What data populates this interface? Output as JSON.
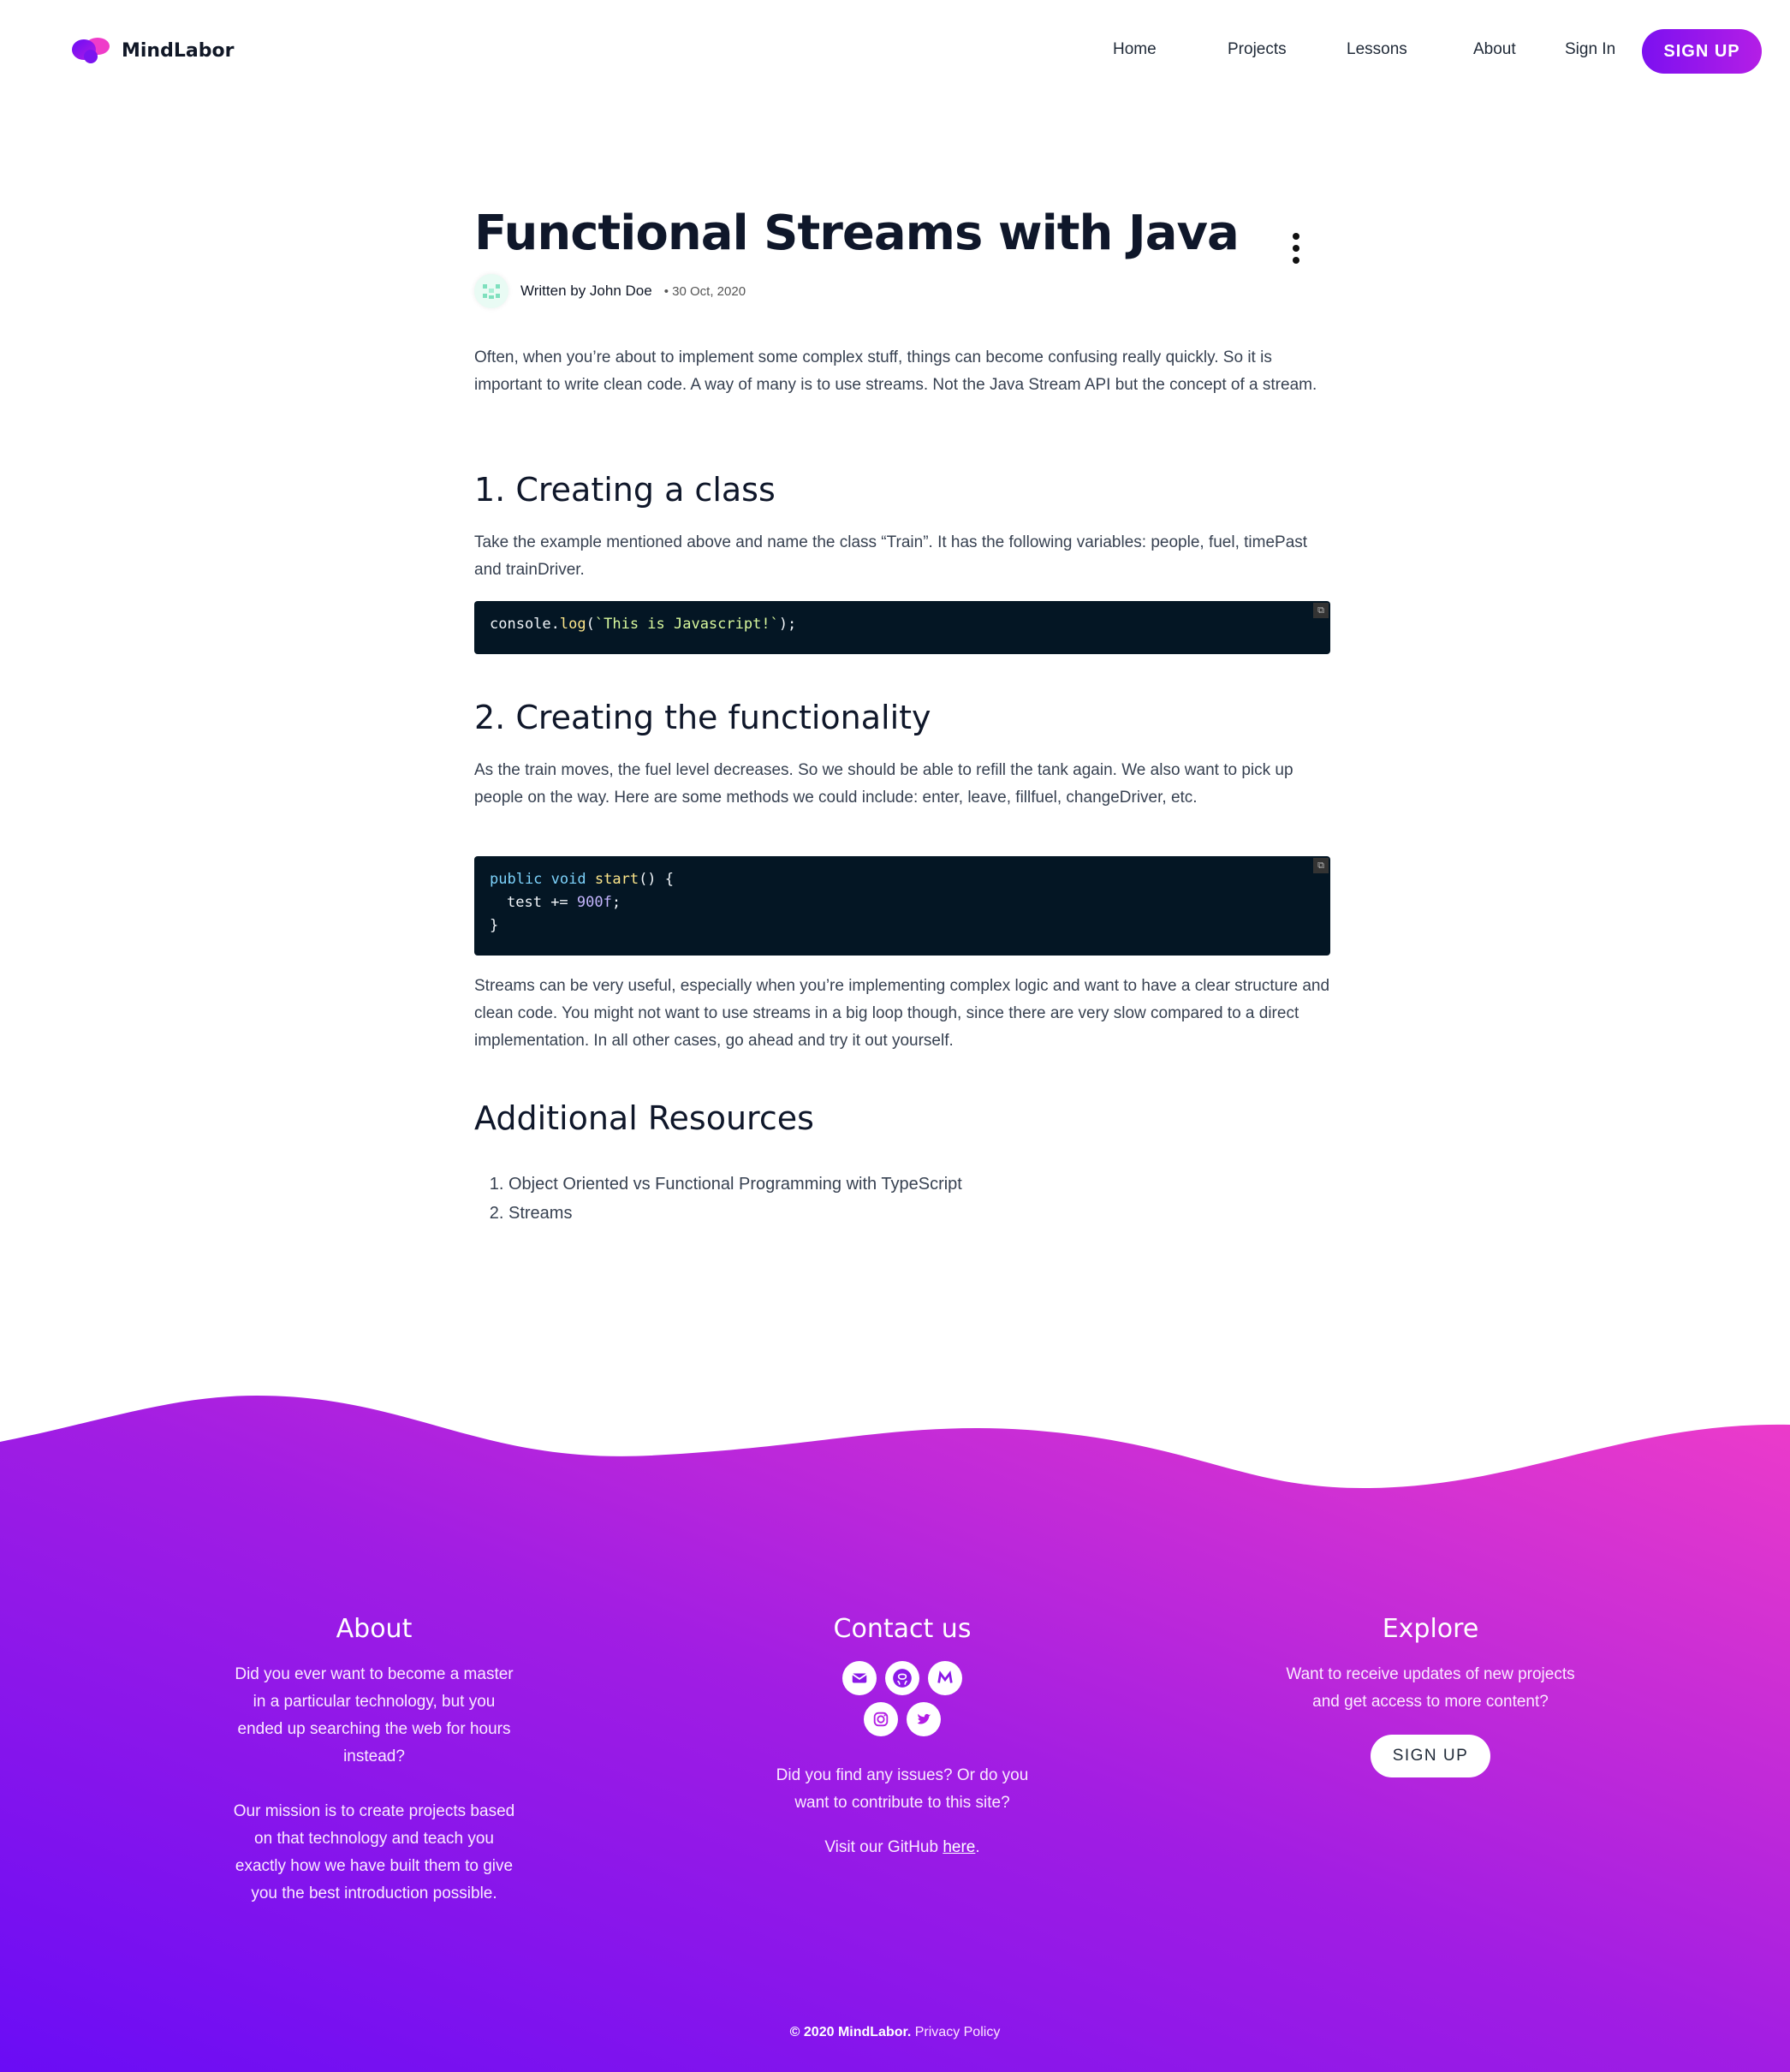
{
  "header": {
    "brand": "MindLabor",
    "nav": [
      "Home",
      "Projects",
      "Lessons",
      "About"
    ],
    "signin": "Sign In",
    "signup": "SIGN UP"
  },
  "article": {
    "title": "Functional Streams with Java",
    "written_by": "Written by John Doe",
    "date": "30 Oct, 2020",
    "intro": "Often, when you’re about to implement some complex stuff, things can become confusing really quickly. So it is important to write clean code. A way of many is to use streams. Not the Java Stream API but the concept of a stream.",
    "section1_title": "1. Creating a class",
    "section1_text": "Take the example mentioned above and name the class “Train”. It has the following variables: people, fuel, timePast and trainDriver.",
    "code1": {
      "obj": "console",
      "dot": ".",
      "fn": "log",
      "open": "(",
      "str": "`This is Javascript!`",
      "close": ");"
    },
    "section2_title": "2. Creating the functionality",
    "section2_text": "As the train moves, the fuel level decreases. So we should be able to refill the tank again. We also want to pick up people on the way. Here are some methods we could include: enter, leave, fillfuel, changeDriver, etc.",
    "code2": {
      "kw1": "public",
      "kw2": "void",
      "fn": "start",
      "sig_rest": "() {",
      "line2_var": "test",
      "line2_op": " += ",
      "line2_num": "900f",
      "line2_end": ";",
      "line3": "}"
    },
    "outro": "Streams can be very useful, especially when you’re implementing complex logic and want to have a clear structure and clean code. You might not want to use streams in a big loop though, since there are very slow compared to a direct implementation. In all other cases, go ahead and try it out yourself.",
    "resources_title": "Additional Resources",
    "resources": [
      "Object Oriented vs Functional Programming with TypeScript",
      "Streams"
    ]
  },
  "footer": {
    "about_title": "About",
    "about_p1": "Did you ever want to become a master in a particular technology, but you ended up searching the web for hours instead?",
    "about_p2": "Our mission is to create projects based on that technology and teach you exactly how we have built them to give you the best introduction possible.",
    "contact_title": "Contact us",
    "social_icons": [
      "mail-icon",
      "github-icon",
      "medium-icon",
      "instagram-icon",
      "twitter-icon"
    ],
    "contact_p": "Did you find any issues? Or do you want to contribute to this site?",
    "visit_prefix": "Visit our GitHub ",
    "visit_link": "here",
    "visit_suffix": ".",
    "explore_title": "Explore",
    "explore_p": "Want to receive updates of new projects and get access to more content?",
    "explore_signup": "SIGN UP",
    "copyright": "© 2020 MindLabor.",
    "privacy": "Privacy Policy"
  },
  "colors": {
    "gradient_start": "#6a0cf5",
    "gradient_mid": "#9b1be6",
    "gradient_end": "#ef3cc9",
    "code_bg": "#041624"
  }
}
